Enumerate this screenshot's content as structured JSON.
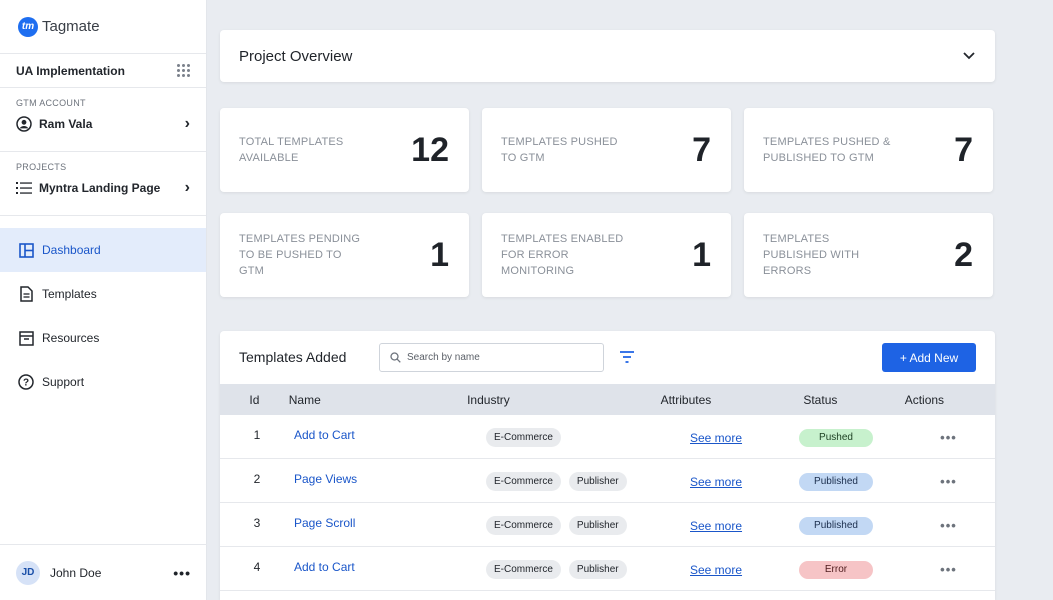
{
  "app": {
    "name": "Tagmate",
    "logo_text": "tm"
  },
  "sidebar": {
    "implementation": "UA Implementation",
    "gtm_account_label": "GTM ACCOUNT",
    "gtm_account_name": "Ram Vala",
    "projects_label": "PROJECTS",
    "project_name": "Myntra Landing Page",
    "nav": [
      {
        "label": "Dashboard",
        "icon": "layout-icon",
        "active": true
      },
      {
        "label": "Templates",
        "icon": "document-icon",
        "active": false
      },
      {
        "label": "Resources",
        "icon": "archive-icon",
        "active": false
      },
      {
        "label": "Support",
        "icon": "help-icon",
        "active": false
      }
    ],
    "user": {
      "initials": "JD",
      "name": "John Doe"
    }
  },
  "overview": {
    "title": "Project Overview"
  },
  "stats": [
    {
      "label": "TOTAL TEMPLATES AVAILABLE",
      "value": "12"
    },
    {
      "label": "TEMPLATES PUSHED TO GTM",
      "value": "7"
    },
    {
      "label": "TEMPLATES PUSHED & PUBLISHED TO GTM",
      "value": "7"
    },
    {
      "label": "TEMPLATES PENDING TO BE PUSHED TO GTM",
      "value": "1"
    },
    {
      "label": "TEMPLATES ENABLED FOR ERROR MONITORING",
      "value": "1"
    },
    {
      "label": "TEMPLATES PUBLISHED WITH ERRORS",
      "value": "2"
    }
  ],
  "templates": {
    "title": "Templates Added",
    "search_placeholder": "Search by name",
    "add_label": "+ Add New",
    "columns": [
      "Id",
      "Name",
      "Industry",
      "Attributes",
      "Status",
      "Actions"
    ],
    "rows": [
      {
        "id": "1",
        "name": "Add to Cart",
        "tags": [
          "E-Commerce"
        ],
        "attributes": "See more",
        "status": "Pushed",
        "status_type": "pushed",
        "actions": "•••"
      },
      {
        "id": "2",
        "name": "Page Views",
        "tags": [
          "E-Commerce",
          "Publisher"
        ],
        "attributes": "See more",
        "status": "Published",
        "status_type": "published",
        "actions": "•••"
      },
      {
        "id": "3",
        "name": "Page Scroll",
        "tags": [
          "E-Commerce",
          "Publisher"
        ],
        "attributes": "See more",
        "status": "Published",
        "status_type": "published",
        "actions": "•••"
      },
      {
        "id": "4",
        "name": "Add to Cart",
        "tags": [
          "E-Commerce",
          "Publisher"
        ],
        "attributes": "See more",
        "status": "Error",
        "status_type": "error",
        "actions": "•••"
      }
    ]
  },
  "colors": {
    "accent": "#1e63e4",
    "pushed": "#c7f1cd",
    "published": "#c2d8f4",
    "error": "#f6c4c6"
  }
}
